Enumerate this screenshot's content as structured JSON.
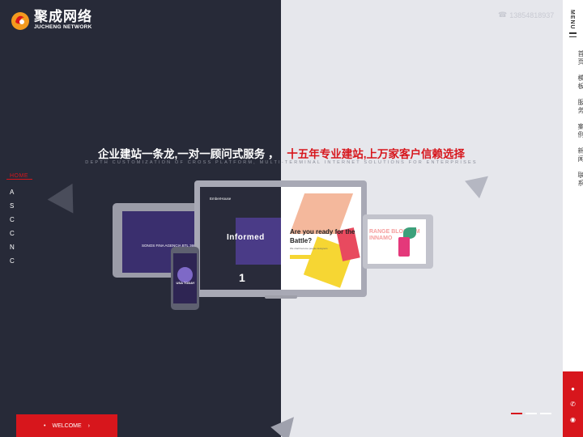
{
  "logo": {
    "cn": "聚成网络",
    "en": "JUCHENG NETWORK"
  },
  "header": {
    "phone": "13854818937"
  },
  "sidebar": {
    "menu_label": "MENU",
    "items": [
      "首页",
      "模板",
      "服务",
      "案例",
      "新闻",
      "联系"
    ]
  },
  "left_nav": {
    "home": "HOME",
    "items": [
      "A",
      "S",
      "C",
      "C",
      "N",
      "C"
    ]
  },
  "hero": {
    "headline_white": "企业建站一条龙,一对一顾问式服务 ，",
    "headline_red": "十五年专业建站,上万家客户信赖选择",
    "subline": "DEPTH CUSTOMIZATION OF CROSS PLATFORM, MULTI-TERMINAL INTERNET SOLUTIONS FOR ENTERPRISES"
  },
  "devices": {
    "tablet_left_text": "SONOS FINA AGENCIA BTL 360",
    "monitor_brand": "EmberHouse",
    "monitor_informed": "Informed",
    "monitor_number": "1",
    "monitor_question": "Are you ready for the Battle?",
    "monitor_small": "We shall become people designers",
    "phone_text": "USA TODAY",
    "tablet_right_text": "RANGE BLOSSOM INNAMO"
  },
  "welcome": {
    "label": "WELCOME"
  },
  "colors": {
    "accent": "#d7161c",
    "dark_bg": "#272a38",
    "light_bg": "#e6e7ec"
  },
  "icons": [
    "phone-icon",
    "menu-icon",
    "chat-icon",
    "call-icon",
    "wechat-icon",
    "arrow-right-icon"
  ]
}
